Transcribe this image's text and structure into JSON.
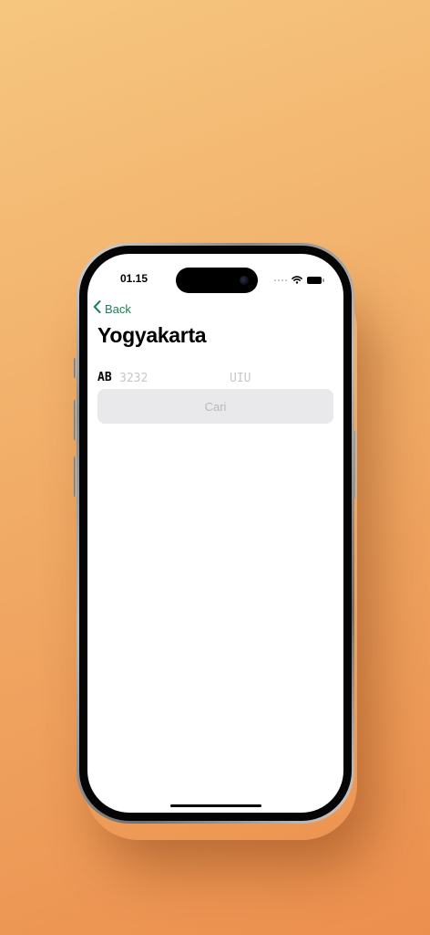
{
  "status_bar": {
    "time": "01.15",
    "wifi_icon": "wifi-icon",
    "battery_icon": "battery-icon",
    "signal_icon": "cellular-signal-icon"
  },
  "nav": {
    "back_label": "Back",
    "back_icon": "chevron-left-icon"
  },
  "page": {
    "title": "Yogyakarta"
  },
  "plate_form": {
    "prefix": "AB",
    "number_placeholder": "3232",
    "number_value": "",
    "suffix_placeholder": "UIU",
    "suffix_value": ""
  },
  "search_button": {
    "label": "Cari",
    "enabled": false
  },
  "colors": {
    "accent": "#1d7f57",
    "button_bg_disabled": "#e9e9eb",
    "button_text_disabled": "#b9b9bd",
    "background_gradient_start": "#f6c67f",
    "background_gradient_end": "#ec8f4e"
  }
}
